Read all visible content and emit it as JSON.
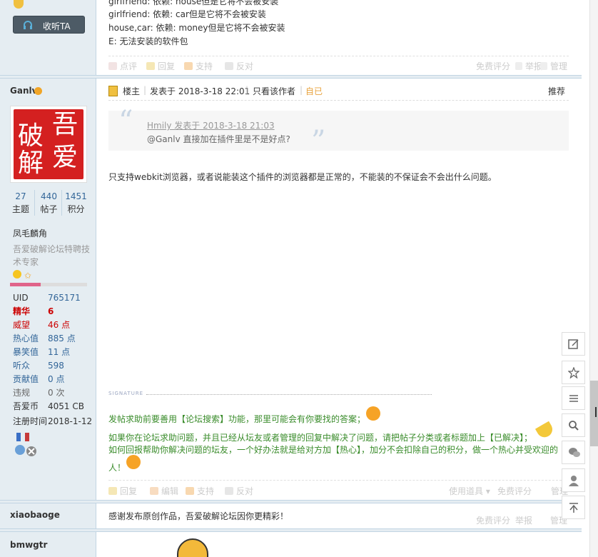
{
  "post1": {
    "code_lines": [
      "girlfriend: 依赖: house但是它将不会被安装",
      "girlfriend: 依赖: car但是它将不会被安装",
      "house,car: 依赖: money但是它将不会被安装",
      "E: 无法安装的软件包"
    ],
    "actions": {
      "rate": "点评",
      "reply": "回复",
      "support": "支持",
      "oppose": "反对",
      "free_rate": "免费评分",
      "report": "举报",
      "manage": "管理"
    },
    "listen_button": "收听TA"
  },
  "post2": {
    "author": "Ganlv",
    "avatar_chars": [
      "吾",
      "破",
      "爱",
      "解"
    ],
    "stats": [
      {
        "value": "27",
        "label": "主题"
      },
      {
        "value": "440",
        "label": "帖子"
      },
      {
        "value": "1451",
        "label": "积分"
      }
    ],
    "title_name": "凤毛麟角",
    "user_title": "吾爱破解论坛特聘技术专家",
    "props": [
      {
        "key": "UID",
        "value": "765171"
      },
      {
        "key": "精华",
        "value": "6"
      },
      {
        "key": "威望",
        "value": "46 点"
      },
      {
        "key": "热心值",
        "value": "885 点"
      },
      {
        "key": "暴笑值",
        "value": "11 点"
      },
      {
        "key": "听众",
        "value": "598"
      },
      {
        "key": "贡献值",
        "value": "0 点"
      },
      {
        "key": "违规",
        "value": "0 次"
      },
      {
        "key": "吾爱币",
        "value": "4051 CB"
      },
      {
        "key": "注册时间",
        "value": "2018-1-12"
      }
    ],
    "header": {
      "floor": "楼主",
      "posted_at": "发表于 2018-3-18 22:01",
      "only_author": "只看该作者",
      "self_tag": "自已",
      "recommend": "推荐"
    },
    "quote": {
      "author_line": "Hmily 发表于 2018-3-18 21:03",
      "text": "@Ganlv 直接加在插件里是不是好点?"
    },
    "body": "只支持webkit浏览器，或者说能装这个插件的浏览器都是正常的，不能装的不保证会不会出什么问题。",
    "signature_label": "SIGNATURE",
    "sig1": "发帖求助前要善用【论坛搜索】功能，那里可能会有你要找的答案；",
    "sig2": "如果你在论坛求助问题，并且已经从坛友或者管理的回复中解决了问题，请把帖子分类或者标题加上【已解决】；",
    "sig3a": "如何回报帮助你解决问题的坛友，一个好办法就是给对方加【热心】，加分不会扣除自己的积分，做一个热心并受欢迎的",
    "sig3b": "人！",
    "actions": {
      "reply": "回复",
      "edit": "编辑",
      "support": "支持",
      "oppose": "反对",
      "use_tool": "使用道具",
      "free_rate": "免费评分",
      "manage": "管理"
    }
  },
  "post3": {
    "author": "xiaobaoge",
    "text": "感谢发布原创作品，吾爱破解论坛因你更精彩！",
    "actions": {
      "free_rate": "免费评分",
      "report": "举报",
      "manage": "管理"
    }
  },
  "post4": {
    "author": "bmwgtr"
  },
  "colors": {
    "sidebar": "#e5edf2",
    "link": "#336699",
    "signature_green": "#3a8c2b",
    "red_value": "#cc0000",
    "listen_btn": "#4d5b66"
  },
  "right_toolbar_icons": [
    "edit-icon",
    "star-icon",
    "menu-icon",
    "search-icon",
    "wechat-icon",
    "user-icon",
    "back-to-top-icon"
  ]
}
